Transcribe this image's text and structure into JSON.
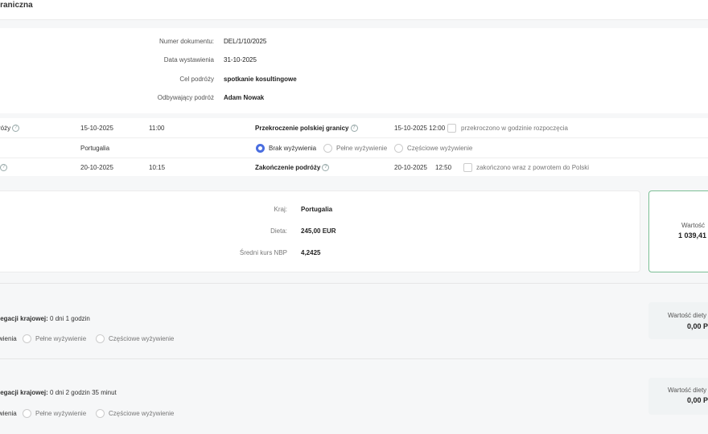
{
  "header": {
    "title": "graniczna"
  },
  "document": {
    "fields": [
      {
        "label": "Numer dokumentu:",
        "value": "DEL/1/10/2025"
      },
      {
        "label": "Data wystawienia",
        "value": "31-10-2025"
      },
      {
        "label": "Cel podróży",
        "value": "spotkanie kosultingowe"
      },
      {
        "label": "Odbywający podróż",
        "value": "Adam Nowak"
      }
    ]
  },
  "trip": {
    "start_label": "róży",
    "start_date": "15-10-2025",
    "start_time": "11:00",
    "border_label": "Przekroczenie polskiej granicy",
    "border_datetime": "15-10-2025 12:00",
    "border_check_label": "przekroczono w godzinie rozpoczęcia",
    "country": "Portugalia",
    "meal_options": [
      "Brak wyżywienia",
      "Pełne wyżywienie",
      "Częściowe wyżywienie"
    ],
    "meal_selected": 0,
    "end_date": "20-10-2025",
    "end_time": "10:15",
    "end_label": "Zakończenie podróży",
    "end_date2": "20-10-2025",
    "end_time2": "12:50",
    "end_check_label": "zakończono wraz z powrotem do Polski"
  },
  "foreign": {
    "country_label": "Kraj:",
    "country_value": "Portugalia",
    "diet_label": "Dieta:",
    "diet_value": "245,00 EUR",
    "rate_label": "Średni kurs NBP",
    "rate_value": "4,2425",
    "total_label": "Wartość",
    "total_value": "1 039,41"
  },
  "domestic": [
    {
      "title_prefix": "legacji krajowej:",
      "duration": "0 dni 1 godzin",
      "meal_options": [
        "wienia",
        "Pełne wyżywienie",
        "Częściowe wyżywienie"
      ],
      "total_label": "Wartość diety",
      "total_value": "0,00 P"
    },
    {
      "title_prefix": "legacji krajowej:",
      "duration": "0 dni 2 godzin 35 minut",
      "meal_options": [
        "wienia",
        "Pełne wyżywienie",
        "Częściowe wyżywienie"
      ],
      "total_label": "Wartość diety",
      "total_value": "0,00 P"
    }
  ],
  "colors": {
    "accent": "#4a6ee0",
    "success_border": "#7cbf96"
  }
}
